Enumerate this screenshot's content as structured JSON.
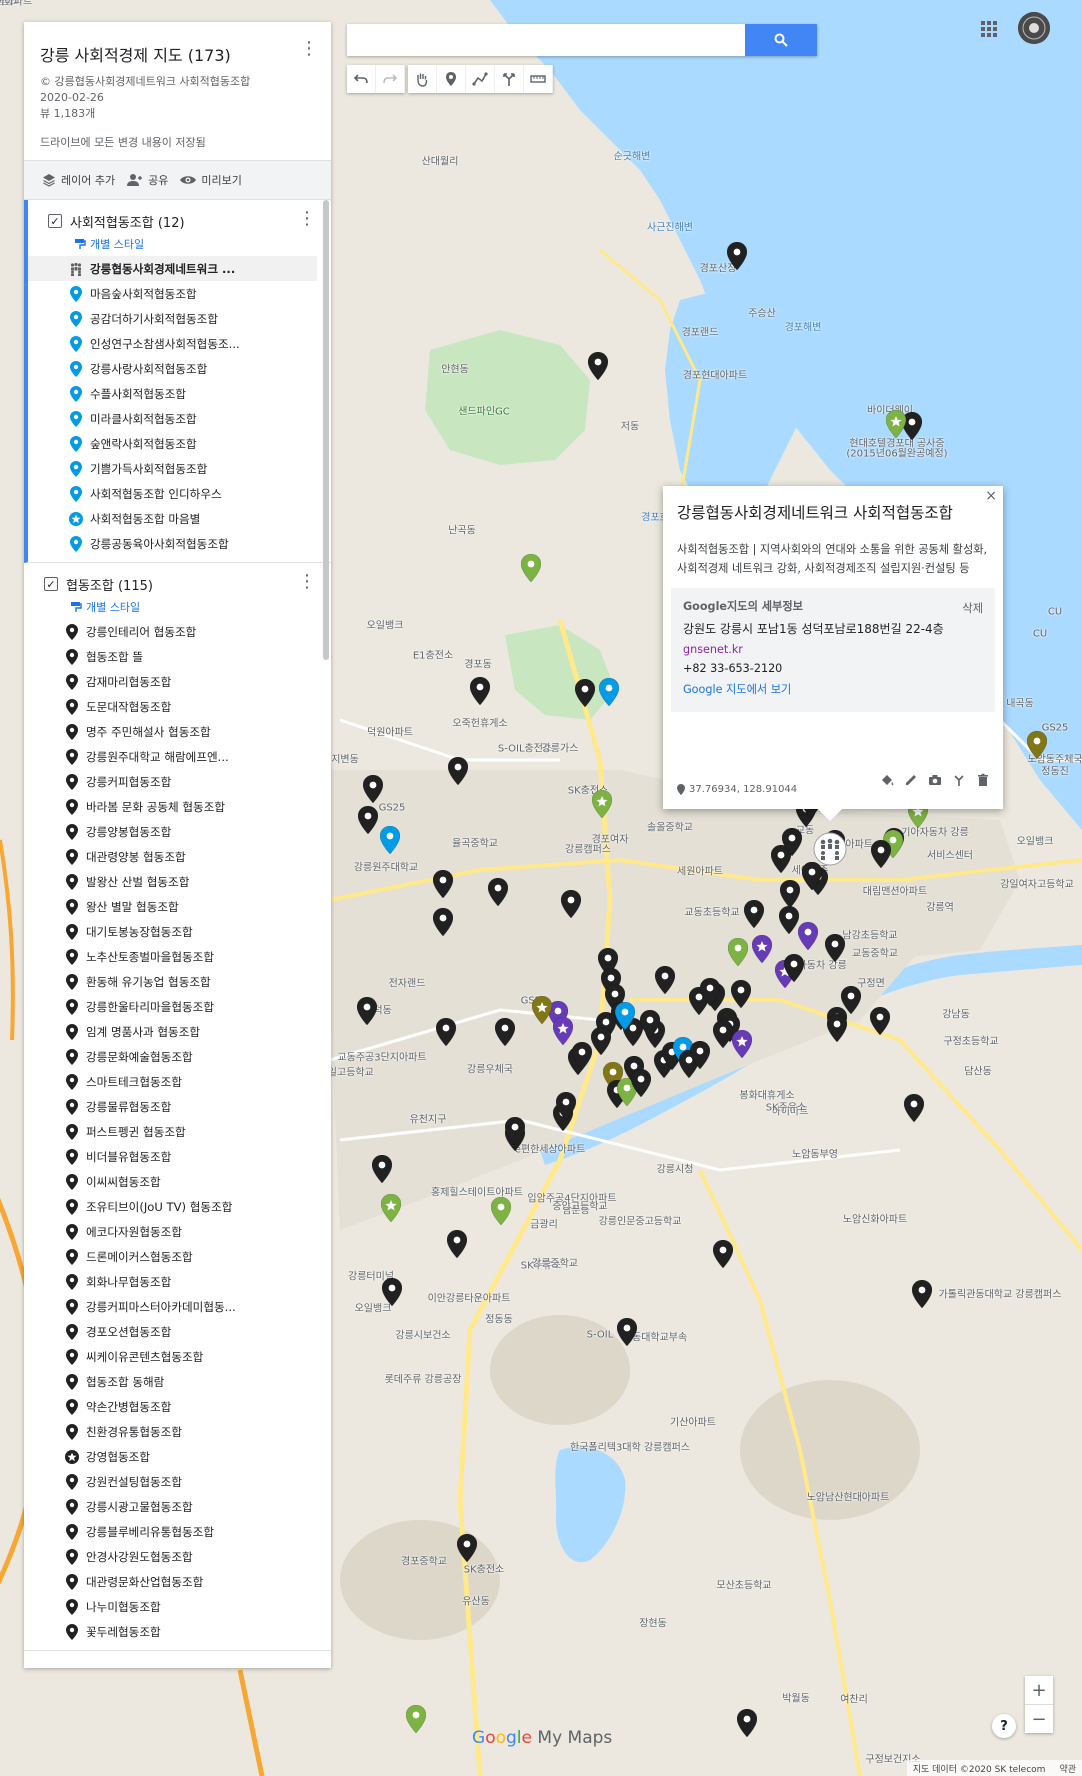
{
  "map": {
    "title": "강릉 사회적경제 지도 (173)",
    "owner": "© 강릉협동사회경제네트워크 사회적협동조합",
    "date": "2020-02-26",
    "views": "뷰 1,183개",
    "saved": "드라이브에 모든 변경 내용이 저장됨"
  },
  "actions": {
    "add_layer": "레이어 추가",
    "share": "공유",
    "preview": "미리보기"
  },
  "colors": {
    "accent": "#4285f4",
    "pin_blue": "#039be5",
    "pin_black": "#212121",
    "pin_green": "#7cb342",
    "pin_purple": "#673ab7",
    "pin_olive": "#827717"
  },
  "layers": [
    {
      "name": "사회적협동조합 (12)",
      "style_label": "개별 스타일",
      "items": [
        {
          "label": "강릉협동사회경제네트워크 ...",
          "icon": "community-icon"
        },
        {
          "label": "마음숲사회적협동조합",
          "icon": "pin-icon"
        },
        {
          "label": "공감더하기사회적협동조합",
          "icon": "pin-icon"
        },
        {
          "label": "인성연구소참샘사회적협동조...",
          "icon": "pin-icon"
        },
        {
          "label": "강릉사랑사회적협동조합",
          "icon": "pin-icon"
        },
        {
          "label": "수플사회적협동조합",
          "icon": "pin-icon"
        },
        {
          "label": "미라클사회적협동조합",
          "icon": "pin-icon"
        },
        {
          "label": "숲앤락사회적협동조합",
          "icon": "pin-icon"
        },
        {
          "label": "기쁨가득사회적협동조합",
          "icon": "pin-icon"
        },
        {
          "label": "사회적협동조합 인디하우스",
          "icon": "pin-icon"
        },
        {
          "label": "사회적협동조합 마음별",
          "icon": "star-pin-icon"
        },
        {
          "label": "강릉공동육아사회적협동조합",
          "icon": "pin-icon"
        }
      ]
    },
    {
      "name": "협동조합 (115)",
      "style_label": "개별 스타일",
      "items": [
        {
          "label": "강릉인테리어 협동조합",
          "icon": "pin-icon"
        },
        {
          "label": "협동조합 뜰",
          "icon": "pin-icon"
        },
        {
          "label": "감재마리협동조합",
          "icon": "pin-icon"
        },
        {
          "label": "도문대작협동조합",
          "icon": "pin-icon"
        },
        {
          "label": "명주 주민해설사 협동조합",
          "icon": "pin-icon"
        },
        {
          "label": "강릉원주대학교 해람에프엔...",
          "icon": "pin-icon"
        },
        {
          "label": "강릉커피협동조합",
          "icon": "pin-icon"
        },
        {
          "label": "바라봄 문화 공동체 협동조합",
          "icon": "pin-icon"
        },
        {
          "label": "강릉양봉협동조합",
          "icon": "pin-icon"
        },
        {
          "label": "대관령양봉 협동조합",
          "icon": "pin-icon"
        },
        {
          "label": "발왕산 산벌 협동조합",
          "icon": "pin-icon"
        },
        {
          "label": "왕산 별말 협동조합",
          "icon": "pin-icon"
        },
        {
          "label": "대기토봉농장협동조합",
          "icon": "pin-icon"
        },
        {
          "label": "노추산토종벌마을협동조합",
          "icon": "pin-icon"
        },
        {
          "label": "환동해 유기농업 협동조합",
          "icon": "pin-icon"
        },
        {
          "label": "강릉한울타리마을협동조합",
          "icon": "pin-icon"
        },
        {
          "label": "임계 명품사과 협동조합",
          "icon": "pin-icon"
        },
        {
          "label": "강릉문화예술협동조합",
          "icon": "pin-icon"
        },
        {
          "label": "스마트테크협동조합",
          "icon": "pin-icon"
        },
        {
          "label": "강릉물류협동조합",
          "icon": "pin-icon"
        },
        {
          "label": "퍼스트펭귄 협동조합",
          "icon": "pin-icon"
        },
        {
          "label": "비더블유협동조합",
          "icon": "pin-icon"
        },
        {
          "label": "이씨씨협동조합",
          "icon": "pin-icon"
        },
        {
          "label": "조유티브이(JoU TV) 협동조합",
          "icon": "pin-icon"
        },
        {
          "label": "에코다자원협동조합",
          "icon": "pin-icon"
        },
        {
          "label": "드론메이커스협동조합",
          "icon": "pin-icon"
        },
        {
          "label": "회화나무협동조합",
          "icon": "pin-icon"
        },
        {
          "label": "강릉커피마스터아카데미협동...",
          "icon": "pin-icon"
        },
        {
          "label": "경포오션협동조합",
          "icon": "pin-icon"
        },
        {
          "label": "씨케이유콘텐츠협동조합",
          "icon": "pin-icon"
        },
        {
          "label": "협동조합 동해람",
          "icon": "pin-icon"
        },
        {
          "label": "약손간병협동조합",
          "icon": "pin-icon"
        },
        {
          "label": "친환경유통협동조합",
          "icon": "pin-icon"
        },
        {
          "label": "강영협동조합",
          "icon": "star-pin-icon"
        },
        {
          "label": "강원컨설팅협동조합",
          "icon": "pin-icon"
        },
        {
          "label": "강릉시광고물협동조합",
          "icon": "pin-icon"
        },
        {
          "label": "강릉블루베리유통협동조합",
          "icon": "pin-icon"
        },
        {
          "label": "안경사강원도협동조합",
          "icon": "pin-icon"
        },
        {
          "label": "대관령문화산업협동조합",
          "icon": "pin-icon"
        },
        {
          "label": "나누미협동조합",
          "icon": "pin-icon"
        },
        {
          "label": "꽃두레협동조합",
          "icon": "pin-icon"
        }
      ]
    }
  ],
  "popup": {
    "title": "강릉협동사회경제네트워크 사회적협동조합",
    "description": "사회적협동조합 | 지역사회와의 연대와 소통을 위한 공동체 활성화, 사회적경제 네트워크 강화, 사회적경제조직 설립지원·컨설팅 등",
    "details_title": "Google지도의 세부정보",
    "delete_label": "삭제",
    "address": "강원도 강릉시 포남1동 성덕포남로188번길 22-4층",
    "website": "gnsenet.kr",
    "phone": "+82 33-653-2120",
    "gmaps_link": "Google 지도에서 보기",
    "coords": "37.76934, 128.91044"
  },
  "map_labels": [
    "산대월리",
    "순긋해변",
    "사근진해변",
    "경포산장",
    "주승산",
    "경포해변",
    "경포랜드",
    "경포현대아파트",
    "안현동",
    "샌드파인GC",
    "저동",
    "바이더웨이",
    "현대호텔경포대 공사중",
    "(2015년06월완공예정)",
    "난곡동",
    "경포호",
    "오일뱅크",
    "E1충전소",
    "경포동",
    "오죽헌휴게소",
    "S-OIL충전소",
    "강릉가스",
    "덕원아파트",
    "SK충전소",
    "지변동",
    "GS25",
    "강릉원주대학교",
    "강릉캠퍼스",
    "율곡중학교",
    "솔올중학교",
    "교동",
    "서임아파트",
    "경포여자",
    "세원아파트",
    "세이브존",
    "교동중학교",
    "교동초등학교",
    "강일여자고등학교",
    "강릉역",
    "대림맨션아파트",
    "기아자동차 강릉",
    "서비스센터",
    "현대자동차 강릉",
    "남강초등학교",
    "전자랜드",
    "GS25",
    "성덕동",
    "교동주공3단지아파트",
    "강릉제일고등학교",
    "강릉우체국",
    "유천지구",
    "e편한세상아파트",
    "하이마트",
    "강릉시청",
    "홍제힐스테이트아파트",
    "남문동",
    "노암동부영",
    "노암신화아파트",
    "강릉인문중고등학교",
    "SK주유소",
    "강릉터미널",
    "오일뱅크",
    "정동동",
    "강릉시보건소",
    "롯데주류 강릉공장",
    "S-OIL",
    "관동대학교부속",
    "가톨릭관동대학교 강릉캠퍼스",
    "기산아파트",
    "한국폴리텍3대학 강릉캠퍼스",
    "노암남산현대아파트",
    "경포중학교",
    "SK충전소",
    "유산동",
    "모산초등학교",
    "장현동",
    "박월동",
    "여찬리",
    "구정보건지소",
    "구정면",
    "구정초등학교",
    "담산동",
    "봉화대휴게소",
    "SK주유소",
    "금광리",
    "입암주공4단지아파트",
    "중앙고등학교",
    "이안강릉타운아파트",
    "강릉중학교",
    "강남동",
    "오일뱅크",
    "노암동주체국",
    "GS25",
    "CU",
    "CU",
    "내곡동",
    "정동진",
    "두산동",
    "송정동",
    "소라해",
    "강릉항",
    "오일뱅크",
    "대명다이아파트"
  ],
  "attribution": {
    "data": "지도 데이터 ©2020 SK telecom",
    "terms": "약관"
  },
  "logo": {
    "google": "Google",
    "product": "My Maps"
  },
  "search": {
    "placeholder": ""
  },
  "zoom": {
    "in": "+",
    "out": "−"
  },
  "help": "?"
}
